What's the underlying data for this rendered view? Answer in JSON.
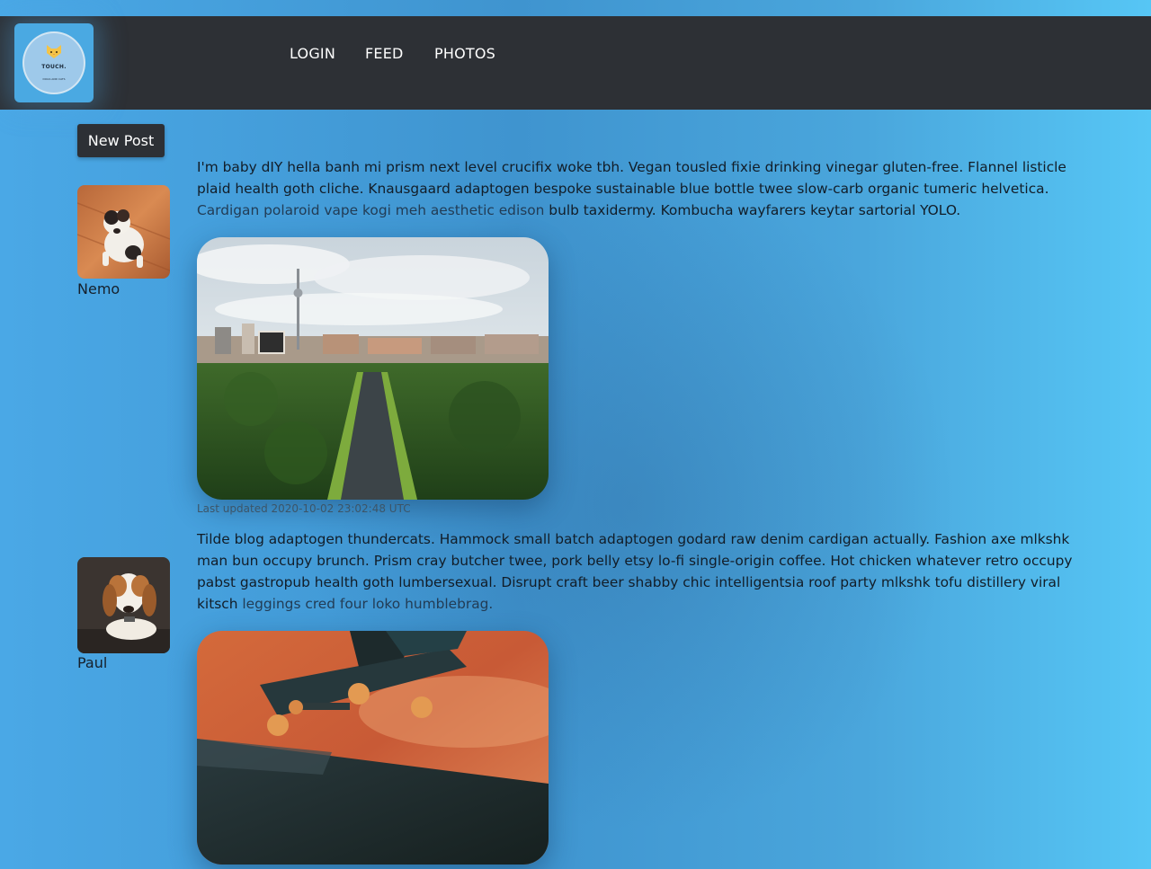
{
  "brand": {
    "name": "TOUCH.",
    "tagline": "DOGS AND CATS",
    "logo_icon": "cat-icon"
  },
  "nav": {
    "links": [
      {
        "label": "LOGIN"
      },
      {
        "label": "FEED"
      },
      {
        "label": "PHOTOS"
      }
    ]
  },
  "actions": {
    "new_post_label": "New Post"
  },
  "posts": [
    {
      "author": "Nemo",
      "avatar": "puppy-photo",
      "text_main": "I'm baby dIY hella banh mi prism next level crucifix woke tbh. Vegan tousled fixie drinking vinegar gluten-free. Flannel listicle plaid health goth cliche. Knausgaard adaptogen bespoke sustainable blue bottle twee slow-carb organic tumeric helvetica. ",
      "text_faded": "Cardigan polaroid vape kogi meh aesthetic edison",
      "text_tail": " bulb taxidermy. Kombucha wayfarers keytar sartorial YOLO.",
      "image": "city-park-photo",
      "timestamp": "Last updated 2020-10-02 23:02:48 UTC"
    },
    {
      "author": "Paul",
      "avatar": "beagle-photo",
      "text_main": "Tilde blog adaptogen thundercats. Hammock small batch adaptogen godard raw denim cardigan actually. Fashion axe mlkshk man bun occupy brunch. Prism cray butcher twee, pork belly etsy lo-fi single-origin coffee. Hot chicken whatever retro occupy pabst gastropub health goth lumbersexual. Disrupt craft beer shabby chic intelligentsia roof party mlkshk tofu distillery viral kitsch ",
      "text_faded": "leggings cred four loko humblebrag.",
      "text_tail": "",
      "image": "skateboard-photo"
    }
  ],
  "colors": {
    "navbar": "#2d3035",
    "background_left": "#4aa8e6",
    "background_right": "#56c6f5"
  }
}
